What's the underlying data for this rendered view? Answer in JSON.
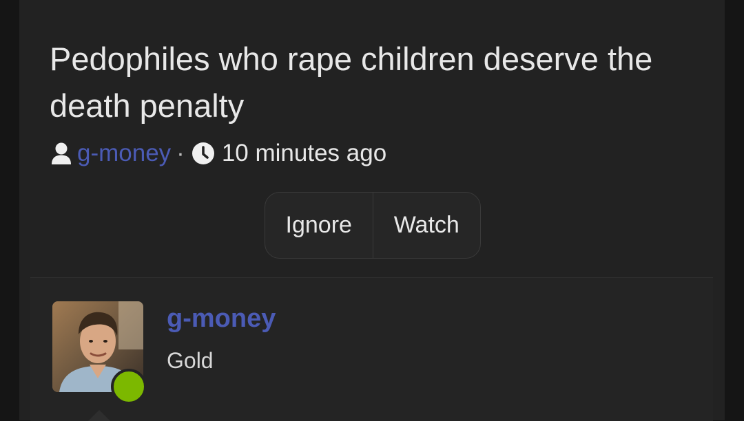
{
  "topic": {
    "title": "Pedophiles who rape children deserve the death penalty",
    "author": "g-money",
    "separator": "·",
    "time_ago": "10 minutes ago"
  },
  "actions": {
    "ignore_label": "Ignore",
    "watch_label": "Watch"
  },
  "post": {
    "author": "g-money",
    "rank": "Gold",
    "online": true
  },
  "icons": {
    "user": "user-icon",
    "clock": "clock-icon"
  },
  "colors": {
    "link": "#4b5bb5",
    "online": "#7cb800",
    "background": "#222222"
  }
}
